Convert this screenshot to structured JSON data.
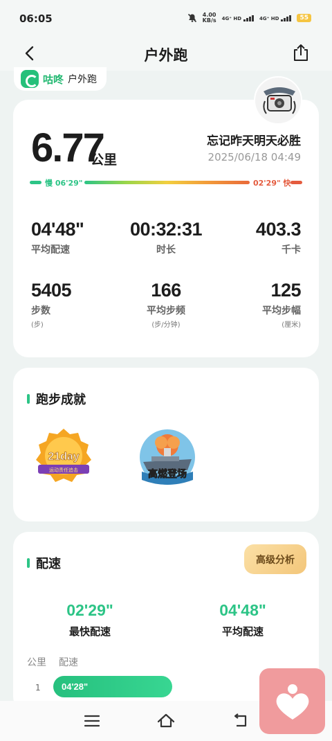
{
  "status_bar": {
    "time": "06:05",
    "net_speed_value": "4.00",
    "net_speed_unit": "KB/s",
    "sim1_label": "4G⁺ HD",
    "sim2_label": "4G⁺ HD",
    "battery": "55"
  },
  "header": {
    "title": "户外跑"
  },
  "brand": {
    "name": "咕咚",
    "sub": "户外跑"
  },
  "summary": {
    "distance": "6.77",
    "distance_unit": "公里",
    "run_name": "忘记昨天明天必胜",
    "datetime": "2025/06/18 04:49",
    "pace_scale": {
      "slow_label": "慢 06'29\"",
      "fast_label": "02'29\" 快"
    },
    "stats": [
      {
        "value": "04'48\"",
        "label": "平均配速",
        "unit": ""
      },
      {
        "value": "00:32:31",
        "label": "时长",
        "unit": ""
      },
      {
        "value": "403.3",
        "label": "千卡",
        "unit": ""
      },
      {
        "value": "5405",
        "label": "步数",
        "unit": "(步)"
      },
      {
        "value": "166",
        "label": "平均步频",
        "unit": "(步/分钟)"
      },
      {
        "value": "125",
        "label": "平均步幅",
        "unit": "(厘米)"
      }
    ]
  },
  "achievements": {
    "title": "跑步成就",
    "badges": [
      {
        "icon": "badge-21day-icon",
        "text": "21day",
        "ribbon": "运动责任追击"
      },
      {
        "icon": "badge-carrier-icon",
        "text": "高燃登场"
      }
    ]
  },
  "pace": {
    "title": "配速",
    "advanced_button": "高级分析",
    "fastest_value": "02'29\"",
    "fastest_label": "最快配速",
    "average_value": "04'48\"",
    "average_label": "平均配速",
    "table_headers": [
      "公里",
      "配速"
    ],
    "rows": [
      {
        "km": "1",
        "pace": "04'28\""
      }
    ]
  },
  "colors": {
    "accent": "#2cc486",
    "fast": "#e45b3e",
    "float_button": "#f09b9d"
  }
}
